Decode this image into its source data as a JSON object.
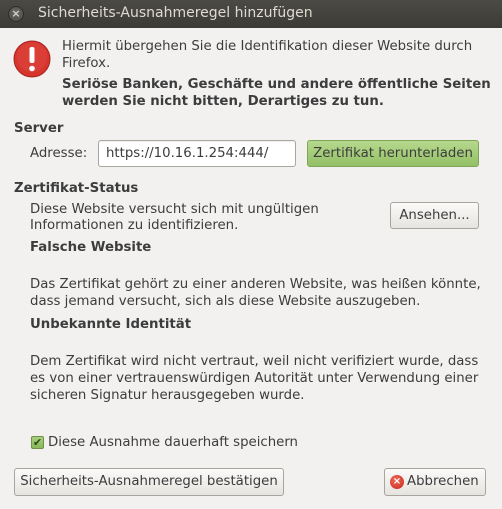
{
  "window": {
    "title": "Sicherheits-Ausnahmeregel hinzufügen",
    "close_glyph": "×"
  },
  "intro": {
    "line1": "Hiermit übergehen Sie die Identifikation dieser Website durch",
    "line2": "Firefox.",
    "bold_line1": "Seriöse Banken, Geschäfte und andere öffentliche Seiten",
    "bold_line2": "werden Sie nicht bitten, Derartiges zu tun.",
    "icon": "warning-exclamation-icon",
    "icon_color": "#d6352d"
  },
  "server": {
    "heading": "Server",
    "address_label": "Adresse:",
    "address_value": "https://10.16.1.254:444/",
    "download_button": "Zertifikat herunterladen",
    "download_button_color": "#a5cc7a"
  },
  "status": {
    "heading": "Zertifikat-Status",
    "desc_line1": "Diese Website versucht sich mit ungültigen",
    "desc_line2": "Informationen zu identifizieren.",
    "view_button": "Ansehen...",
    "wrong_site": {
      "heading": "Falsche Website",
      "line1": "Das Zertifikat gehört zu einer anderen Website, was heißen könnte,",
      "line2": "dass jemand versucht, sich als diese Website auszugeben."
    },
    "unknown_identity": {
      "heading": "Unbekannte Identität",
      "line1": "Dem Zertifikat wird nicht vertraut, weil nicht verifiziert wurde, dass",
      "line2": "es von einer vertrauenswürdigen Autorität unter Verwendung einer",
      "line3": "sicheren Signatur herausgegeben wurde."
    }
  },
  "permanent": {
    "label": "Diese Ausnahme dauerhaft speichern",
    "checked": true,
    "check_glyph": "✔"
  },
  "actions": {
    "confirm_button": "Sicherheits-Ausnahmeregel bestätigen",
    "cancel_button": "Abbrechen",
    "cancel_icon": "cancel-icon",
    "cancel_glyph": "×"
  }
}
